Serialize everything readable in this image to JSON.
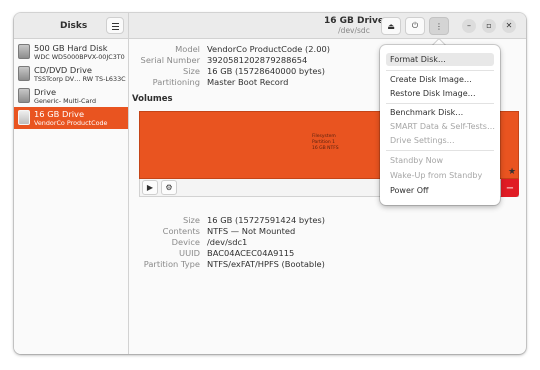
{
  "sidebar": {
    "title": "Disks",
    "drives": [
      {
        "name": "500 GB Hard Disk",
        "desc": "WDC WD5000BPVX-00JC3T0",
        "selected": false
      },
      {
        "name": "CD/DVD Drive",
        "desc": "TSSTcorp DV… RW TS-L633C",
        "selected": false
      },
      {
        "name": "Drive",
        "desc": "Generic- Multi-Card",
        "selected": false
      },
      {
        "name": "16 GB Drive",
        "desc": "VendorCo ProductCode",
        "selected": true
      }
    ]
  },
  "header": {
    "title": "16 GB Drive",
    "subtitle": "/dev/sdc"
  },
  "disk_info": {
    "model_label": "Model",
    "model_value": "VendorCo ProductCode (2.00)",
    "serial_label": "Serial Number",
    "serial_value": "3920581202879288654",
    "size_label": "Size",
    "size_value": "16 GB (15728640000 bytes)",
    "partitioning_label": "Partitioning",
    "partitioning_value": "Master Boot Record"
  },
  "volumes": {
    "title": "Volumes",
    "partition_label_line1": "Filesystem",
    "partition_label_line2": "Partition 1",
    "partition_label_line3": "16 GB NTFS"
  },
  "partition_info": {
    "size_label": "Size",
    "size_value": "16 GB (15727591424 bytes)",
    "contents_label": "Contents",
    "contents_value": "NTFS — Not Mounted",
    "device_label": "Device",
    "device_value": "/dev/sdc1",
    "uuid_label": "UUID",
    "uuid_value": "BAC04ACEC04A9115",
    "ptype_label": "Partition Type",
    "ptype_value": "NTFS/exFAT/HPFS (Bootable)"
  },
  "menu": {
    "format": "Format Disk…",
    "create_image": "Create Disk Image…",
    "restore_image": "Restore Disk Image…",
    "benchmark": "Benchmark Disk…",
    "smart": "SMART Data & Self-Tests…",
    "settings": "Drive Settings…",
    "standby": "Standby Now",
    "wakeup": "Wake-Up from Standby",
    "poweroff": "Power Off"
  },
  "colors": {
    "accent": "#e95420",
    "destructive": "#e01b24"
  }
}
